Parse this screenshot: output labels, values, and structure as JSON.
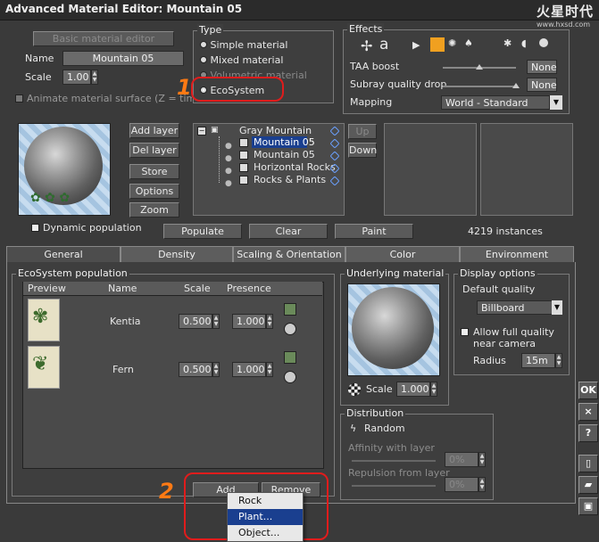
{
  "window": {
    "title": "Advanced Material Editor: Mountain 05",
    "logo_text": "火星时代",
    "logo_url": "www.hxsd.com"
  },
  "left_top": {
    "basic_editor_btn": "Basic material editor",
    "name_label": "Name",
    "name_value": "Mountain 05",
    "scale_label": "Scale",
    "scale_value": "1.00",
    "animate_label": "Animate material surface (Z = time)"
  },
  "type": {
    "title": "Type",
    "options": [
      "Simple material",
      "Mixed material",
      "Volumetric material",
      "EcoSystem"
    ],
    "selected": "EcoSystem"
  },
  "effects": {
    "title": "Effects",
    "taa_label": "TAA boost",
    "taa_value": "None",
    "subray_label": "Subray quality drop",
    "subray_value": "None",
    "mapping_label": "Mapping",
    "mapping_value": "World - Standard",
    "taa_level": 0.5,
    "subray_level": 1.0
  },
  "layers": {
    "add": "Add layer",
    "del": "Del layer",
    "store": "Store",
    "options": "Options",
    "zoom": "Zoom",
    "up": "Up",
    "down": "Down",
    "tree": [
      "Gray Mountain",
      "Mountain 05",
      "Mountain 05",
      "Horizontal Rocks",
      "Rocks & Plants"
    ],
    "dynamic_population": "Dynamic population",
    "populate": "Populate",
    "clear": "Clear",
    "paint": "Paint",
    "instances": "4219 instances"
  },
  "tabs": [
    "General",
    "Density",
    "Scaling & Orientation",
    "Color",
    "Environment"
  ],
  "ecosystem": {
    "title": "EcoSystem population",
    "columns": [
      "Preview",
      "Name",
      "Scale",
      "Presence"
    ],
    "rows": [
      {
        "name": "Kentia",
        "scale": "0.500",
        "presence": "1.000"
      },
      {
        "name": "Fern",
        "scale": "0.500",
        "presence": "1.000"
      }
    ],
    "add_btn": "Add",
    "remove_btn": "Remove"
  },
  "underlying": {
    "title": "Underlying material",
    "scale_label": "Scale",
    "scale_value": "1.000"
  },
  "display": {
    "title": "Display options",
    "default_quality_label": "Default quality",
    "quality_value": "Billboard",
    "allow_label_1": "Allow full quality",
    "allow_label_2": "near camera",
    "radius_label": "Radius",
    "radius_value": "15m"
  },
  "distribution": {
    "title": "Distribution",
    "random_label": "Random",
    "affinity_label": "Affinity with layer",
    "affinity_value": "0%",
    "repulsion_label": "Repulsion from layer",
    "repulsion_value": "0%"
  },
  "side": {
    "ok": "OK",
    "x": "×",
    "help": "?"
  },
  "menu": {
    "items": [
      "Rock",
      "Plant...",
      "Object..."
    ],
    "selected": "Plant..."
  },
  "annotations": {
    "n1": "1",
    "n2": "2"
  },
  "colors": {
    "annotation_red": "#e01c1c",
    "annotation_orange": "#ff7a14",
    "menu_select": "#1a3f8f"
  }
}
